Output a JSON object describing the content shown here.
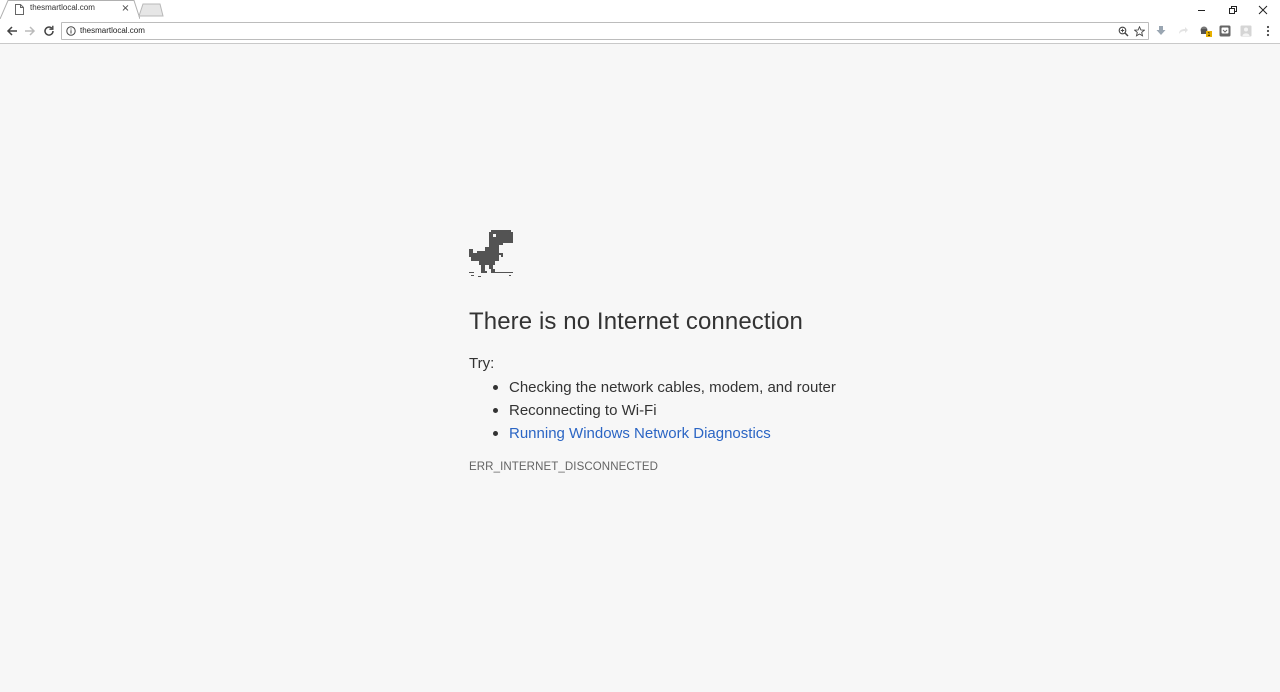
{
  "tab": {
    "title": "thesmartlocal.com",
    "favicon": "page-icon",
    "close_glyph": "×"
  },
  "window_controls": [
    "minimize-icon",
    "restore-icon",
    "close-icon"
  ],
  "toolbar": {
    "url": "thesmartlocal.com",
    "icons": [
      "back-icon",
      "forward-icon",
      "reload-icon",
      "info-icon",
      "zoom-icon",
      "star-icon"
    ],
    "extensions": [
      "download-extension-icon",
      "share-extension-icon",
      "extension-badge-icon",
      "pocket-extension-icon",
      "user-extension-icon",
      "menu-icon"
    ]
  },
  "error_page": {
    "icon": "dino-icon",
    "heading": "There is no Internet connection",
    "try_label": "Try:",
    "suggestions": [
      {
        "text": "Checking the network cables, modem, and router",
        "link": false
      },
      {
        "text": "Reconnecting to Wi-Fi",
        "link": false
      },
      {
        "text": "Running Windows Network Diagnostics",
        "link": true
      }
    ],
    "error_code": "ERR_INTERNET_DISCONNECTED"
  },
  "colors": {
    "page_background": "#f7f7f7",
    "link": "#2b65c4",
    "text": "#333333",
    "error_code": "#646464"
  }
}
